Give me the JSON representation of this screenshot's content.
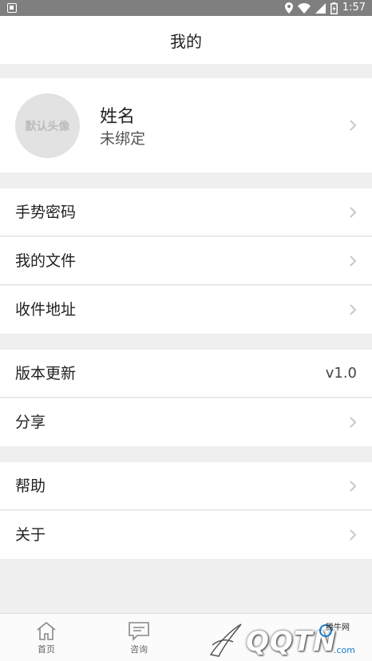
{
  "status_bar": {
    "time": "1:57"
  },
  "header": {
    "title": "我的"
  },
  "profile": {
    "avatar_text": "默认头像",
    "name": "姓名",
    "binding_status": "未绑定"
  },
  "menu_group_1": [
    {
      "label": "手势密码"
    },
    {
      "label": "我的文件"
    },
    {
      "label": "收件地址"
    }
  ],
  "menu_group_2": {
    "version": {
      "label": "版本更新",
      "value": "v1.0"
    },
    "share": {
      "label": "分享"
    }
  },
  "menu_group_3": [
    {
      "label": "帮助"
    },
    {
      "label": "关于"
    }
  ],
  "tab_bar": {
    "tabs": [
      {
        "label": "首页",
        "icon": "home-icon"
      },
      {
        "label": "咨询",
        "icon": "chat-icon"
      }
    ]
  },
  "watermark": {
    "text": "QQTN",
    "site": "腾牛网",
    "domain": ".com"
  },
  "colors": {
    "background": "#efefef",
    "status_bar": "#7f7f7f",
    "card": "#ffffff",
    "chevron": "#c8c8c8"
  }
}
